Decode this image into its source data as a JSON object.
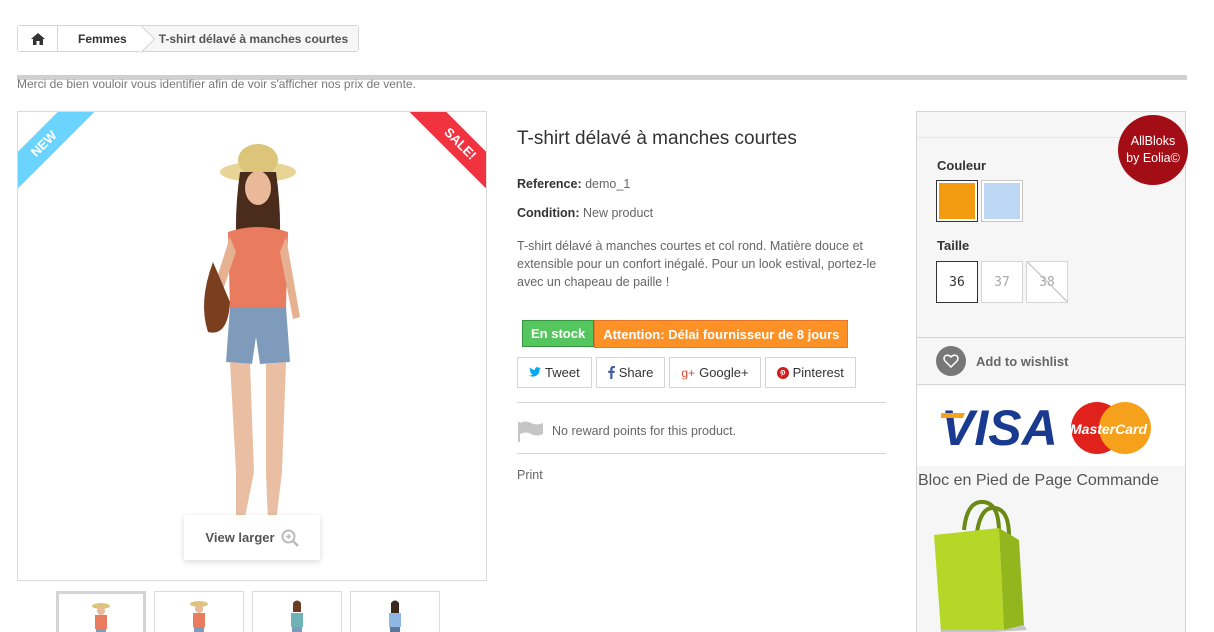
{
  "breadcrumb": {
    "home_icon": "home-icon",
    "items": [
      "Femmes"
    ],
    "current": "T-shirt délavé à manches courtes"
  },
  "notice": "Merci de bien vouloir vous identifier afin de voir s'afficher nos prix de vente.",
  "image": {
    "ribbon_new": "NEW",
    "ribbon_sale": "SALE!",
    "view_larger": "View larger",
    "ribbon_new_color": "#6ad4ff",
    "ribbon_sale_color": "#f13340"
  },
  "product": {
    "title": "T-shirt délavé à manches courtes",
    "reference_label": "Reference:",
    "reference_value": "demo_1",
    "condition_label": "Condition:",
    "condition_value": "New product",
    "description": "T-shirt délavé à manches courtes et col rond. Matière douce et extensible pour un confort inégalé. Pour un look estival, portez-le avec un chapeau de paille !",
    "stock_badge": "En stock",
    "warning_badge": "Attention: Délai fournisseur de 8 jours",
    "stock_color": "#55c65e",
    "warning_color": "#fe9126"
  },
  "social": {
    "tweet": "Tweet",
    "share": "Share",
    "google": "Google+",
    "pinterest": "Pinterest"
  },
  "reward_text": "No reward points for this product.",
  "print_label": "Print",
  "attributes": {
    "color_label": "Couleur",
    "colors": [
      "#f39c11",
      "#bdd6f3"
    ],
    "size_label": "Taille",
    "sizes": [
      "36",
      "37",
      "38"
    ],
    "selected_size": "36",
    "disabled_size": "38"
  },
  "wishlist_label": "Add to wishlist",
  "payment": {
    "visa": "VISA",
    "mastercard": "MasterCard"
  },
  "footer_block_title": "Bloc en Pied de Page Commande",
  "allbloks": {
    "line1": "AllBloks",
    "line2": "by Eolia©"
  }
}
